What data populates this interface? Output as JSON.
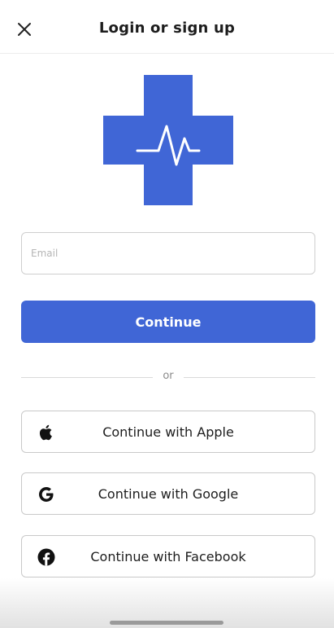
{
  "header": {
    "title": "Login or sign up",
    "close_icon": "close-icon"
  },
  "logo": {
    "icon": "medical-cross-heartbeat-icon",
    "cross_color": "#4066d6",
    "line_color": "#ffffff"
  },
  "email": {
    "placeholder": "Email",
    "value": ""
  },
  "continue_button": {
    "label": "Continue",
    "color": "#4066d6"
  },
  "divider": {
    "text": "or"
  },
  "social": [
    {
      "label": "Continue with Apple",
      "icon": "apple-icon"
    },
    {
      "label": "Continue with Google",
      "icon": "google-icon"
    },
    {
      "label": "Continue with Facebook",
      "icon": "facebook-icon"
    }
  ]
}
